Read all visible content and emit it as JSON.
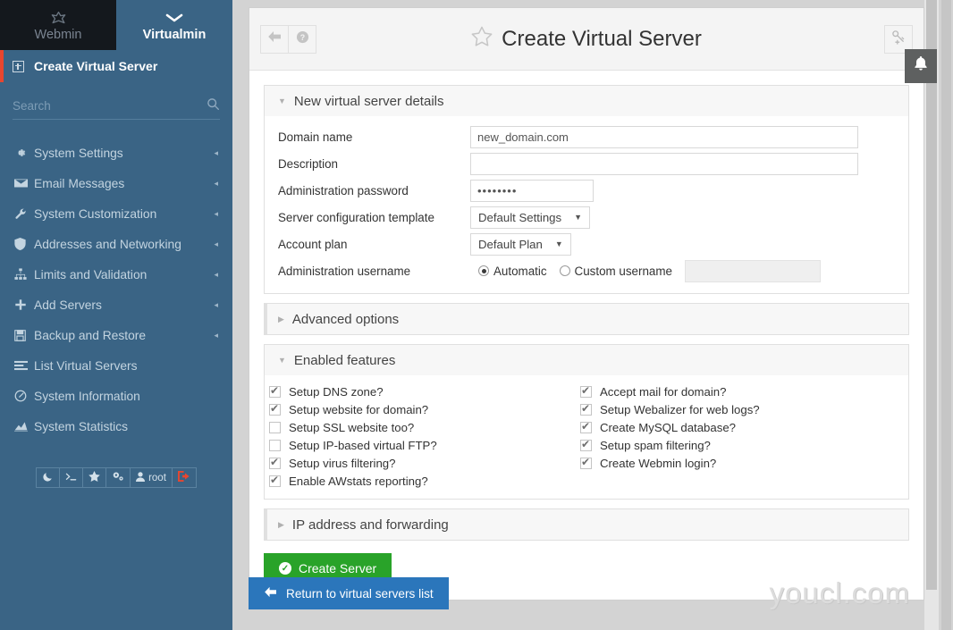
{
  "sidebar": {
    "tabs": [
      {
        "label": "Webmin",
        "icon": "webmin-logo-icon",
        "active": false
      },
      {
        "label": "Virtualmin",
        "icon": "chevron-down-icon",
        "active": true
      }
    ],
    "active_nav": {
      "label": "Create Virtual Server",
      "icon": "plus-box-icon"
    },
    "search": {
      "placeholder": "Search",
      "value": "",
      "icon": "search-icon"
    },
    "items": [
      {
        "label": "System Settings",
        "icon": "gear-icon",
        "caret": "◂"
      },
      {
        "label": "Email Messages",
        "icon": "envelope-icon",
        "caret": "◂"
      },
      {
        "label": "System Customization",
        "icon": "wrench-icon",
        "caret": "◂"
      },
      {
        "label": "Addresses and Networking",
        "icon": "shield-icon",
        "caret": "◂"
      },
      {
        "label": "Limits and Validation",
        "icon": "sitemap-icon",
        "caret": "◂"
      },
      {
        "label": "Add Servers",
        "icon": "plus-icon",
        "caret": "◂"
      },
      {
        "label": "Backup and Restore",
        "icon": "save-icon",
        "caret": "◂"
      },
      {
        "label": "List Virtual Servers",
        "icon": "list-icon",
        "caret": ""
      },
      {
        "label": "System Information",
        "icon": "dashboard-icon",
        "caret": ""
      },
      {
        "label": "System Statistics",
        "icon": "chart-area-icon",
        "caret": ""
      }
    ],
    "bottom_bar": [
      {
        "name": "theme-night-mode-button",
        "icon": "moon-icon",
        "label": ""
      },
      {
        "name": "terminal-button",
        "icon": "terminal-icon",
        "label": ""
      },
      {
        "name": "favorites-button",
        "icon": "star-icon",
        "label": ""
      },
      {
        "name": "settings-button",
        "icon": "gears-icon",
        "label": ""
      },
      {
        "name": "current-user-button",
        "icon": "user-icon",
        "label": "root"
      },
      {
        "name": "logout-button",
        "icon": "logout-icon",
        "label": ""
      }
    ]
  },
  "header": {
    "back_icon": "arrow-left-icon",
    "help_icon": "question-circle-icon",
    "favorite_icon": "star-outline-icon",
    "title": "Create Virtual Server",
    "right_icon": "key-plus-icon",
    "bell_icon": "bell-icon"
  },
  "panels": {
    "details": {
      "title": "New virtual server details",
      "expanded": true,
      "fields": {
        "domain_name": {
          "label": "Domain name",
          "value": "new_domain.com",
          "placeholder": ""
        },
        "description": {
          "label": "Description",
          "value": "",
          "placeholder": ""
        },
        "admin_password": {
          "label": "Administration password",
          "value": "••••••••"
        },
        "config_template": {
          "label": "Server configuration template",
          "selected": "Default Settings",
          "arrow": "▼"
        },
        "account_plan": {
          "label": "Account plan",
          "selected": "Default Plan",
          "arrow": "▼"
        },
        "admin_username": {
          "label": "Administration username",
          "options": [
            {
              "label": "Automatic",
              "selected": true
            },
            {
              "label": "Custom username",
              "selected": false
            }
          ],
          "custom_value": "",
          "custom_disabled": true
        }
      }
    },
    "advanced": {
      "title": "Advanced options",
      "expanded": false
    },
    "features": {
      "title": "Enabled features",
      "expanded": true,
      "left_column": [
        {
          "label": "Setup DNS zone?",
          "checked": true
        },
        {
          "label": "Setup website for domain?",
          "checked": true
        },
        {
          "label": "Setup SSL website too?",
          "checked": false
        },
        {
          "label": "Setup IP-based virtual FTP?",
          "checked": false
        },
        {
          "label": "Setup virus filtering?",
          "checked": true
        },
        {
          "label": "Enable AWstats reporting?",
          "checked": true
        }
      ],
      "right_column": [
        {
          "label": "Accept mail for domain?",
          "checked": true
        },
        {
          "label": "Setup Webalizer for web logs?",
          "checked": true
        },
        {
          "label": "Create MySQL database?",
          "checked": true
        },
        {
          "label": "Setup spam filtering?",
          "checked": true
        },
        {
          "label": "Create Webmin login?",
          "checked": true
        }
      ]
    },
    "ip": {
      "title": "IP address and forwarding",
      "expanded": false
    }
  },
  "buttons": {
    "create_server": {
      "label": "Create Server",
      "icon": "check-circle-icon"
    },
    "return_list": {
      "label": "Return to virtual servers list",
      "icon": "arrow-left-icon"
    }
  },
  "watermark": "youcl.com",
  "colors": {
    "sidebar": "#3a6485",
    "webmin_tab": "#14181d",
    "accent_red": "#e8462f",
    "create_green": "#29a329",
    "return_blue": "#2b76bb",
    "page_bg": "#d3d3d3"
  }
}
